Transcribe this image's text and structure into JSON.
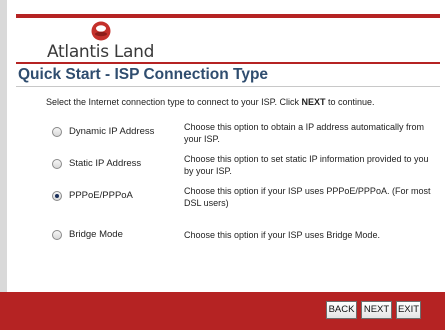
{
  "header": {
    "logo_text": "Atlantis Land",
    "colors": {
      "brand_red": "#b52323",
      "title_blue": "#2f4d6f"
    }
  },
  "page": {
    "title": "Quick Start - ISP Connection Type",
    "instructions_prefix": "Select the Internet connection type to connect to your ISP. Click ",
    "instructions_bold": "NEXT",
    "instructions_suffix": " to continue."
  },
  "options": [
    {
      "label": "Dynamic IP Address",
      "description": "Choose this option to obtain a IP address automatically from your ISP.",
      "selected": false
    },
    {
      "label": "Static IP Address",
      "description": "Choose this option to set static IP information provided to you by your ISP.",
      "selected": false
    },
    {
      "label": "PPPoE/PPPoA",
      "description": "Choose this option if your ISP uses PPPoE/PPPoA. (For most DSL users)",
      "selected": true
    },
    {
      "label": "Bridge Mode",
      "description": "Choose this option if your ISP uses Bridge Mode.",
      "selected": false
    }
  ],
  "footer": {
    "back_label": "BACK",
    "next_label": "NEXT",
    "exit_label": "EXIT"
  }
}
